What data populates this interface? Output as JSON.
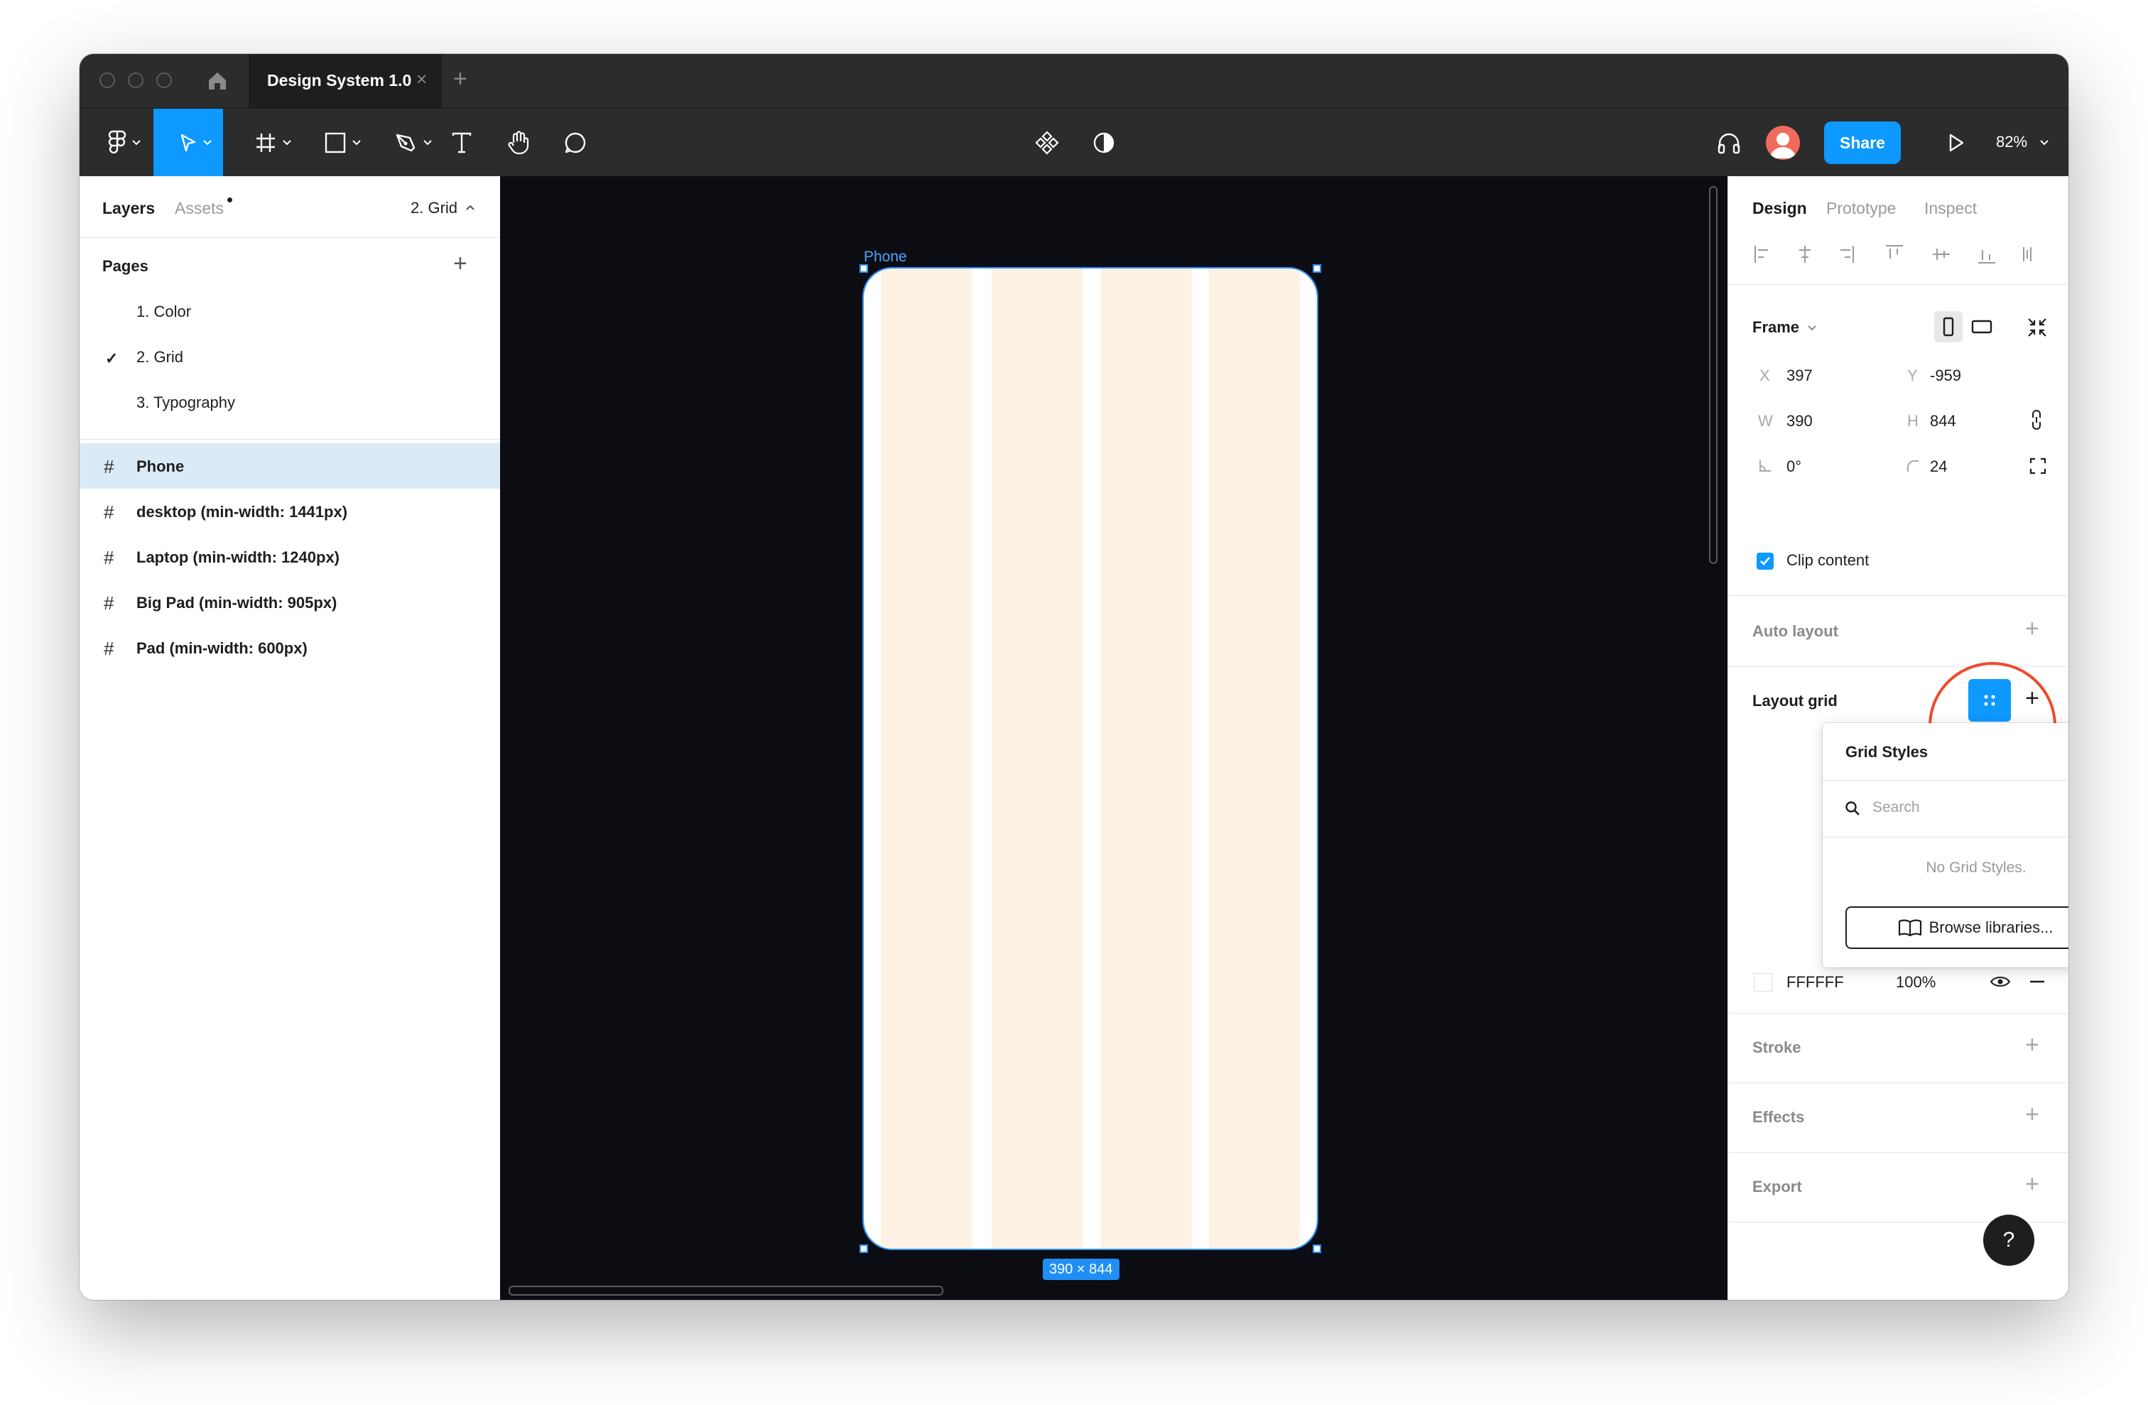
{
  "window": {
    "tab_title": "Design System 1.0",
    "tab_close": "×",
    "new_tab": "+"
  },
  "toolbar": {
    "share_label": "Share",
    "zoom": "82%"
  },
  "left_panel": {
    "tabs": [
      {
        "label": "Layers",
        "active": true
      },
      {
        "label": "Assets",
        "active": false
      }
    ],
    "current_page": "2. Grid",
    "pages_header": "Pages",
    "pages": [
      {
        "label": "1. Color",
        "selected": false
      },
      {
        "label": "2. Grid",
        "selected": true
      },
      {
        "label": "3. Typography",
        "selected": false
      }
    ],
    "layers": [
      {
        "label": "Phone",
        "selected": true
      },
      {
        "label": "desktop (min-width: 1441px)",
        "selected": false
      },
      {
        "label": "Laptop (min-width: 1240px)",
        "selected": false
      },
      {
        "label": "Big Pad (min-width: 905px)",
        "selected": false
      },
      {
        "label": "Pad (min-width: 600px)",
        "selected": false
      }
    ]
  },
  "canvas": {
    "frame_label": "Phone",
    "dimensions": "390 × 844",
    "frame_background": "#ffffff",
    "grid_column_color": "#fdf1e3",
    "selection_color": "#2b8fff"
  },
  "right_panel": {
    "tabs": [
      {
        "label": "Design",
        "active": true
      },
      {
        "label": "Prototype",
        "active": false
      },
      {
        "label": "Inspect",
        "active": false
      }
    ],
    "frame": {
      "title": "Frame",
      "x_label": "X",
      "x": "397",
      "y_label": "Y",
      "y": "-959",
      "w_label": "W",
      "w": "390",
      "h_label": "H",
      "h": "844",
      "rotation": "0°",
      "radius": "24",
      "clip_content_label": "Clip content",
      "clip_content": true
    },
    "auto_layout_title": "Auto layout",
    "layout_grid_title": "Layout grid",
    "fill": {
      "hex": "FFFFFF",
      "opacity": "100%"
    },
    "stroke_title": "Stroke",
    "effects_title": "Effects",
    "export_title": "Export"
  },
  "grid_styles_popup": {
    "title": "Grid Styles",
    "search_placeholder": "Search",
    "empty_text": "No Grid Styles.",
    "browse_label": "Browse libraries..."
  },
  "help_label": "?",
  "colors": {
    "accent": "#0d99ff",
    "annotation_circle": "#ef4a2b",
    "canvas_bg": "#0b0d12",
    "chrome_bg": "#2c2c2c"
  }
}
